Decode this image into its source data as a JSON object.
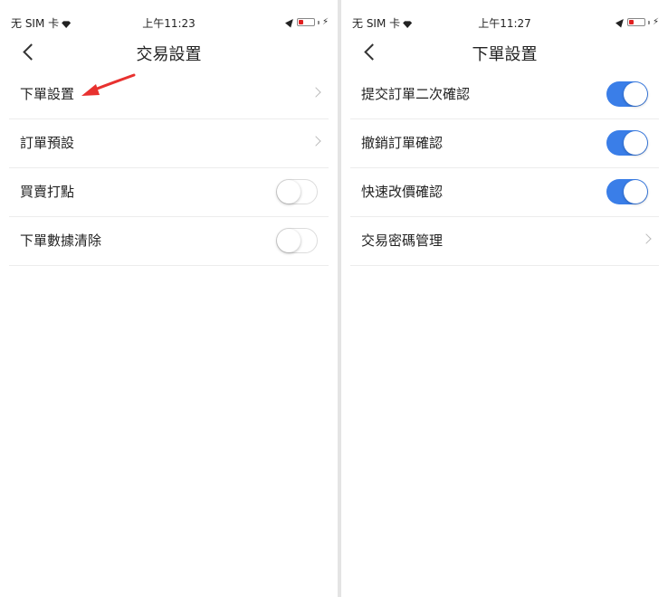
{
  "left": {
    "status": {
      "carrier": "无 SIM 卡",
      "time": "上午11:23"
    },
    "nav": {
      "title": "交易設置"
    },
    "items": [
      {
        "label": "下單設置",
        "control": "chevron"
      },
      {
        "label": "訂單預設",
        "control": "chevron"
      },
      {
        "label": "買賣打點",
        "control": "toggle",
        "on": false
      },
      {
        "label": "下單數據清除",
        "control": "toggle",
        "on": false
      }
    ]
  },
  "right": {
    "status": {
      "carrier": "无 SIM 卡",
      "time": "上午11:27"
    },
    "nav": {
      "title": "下單設置"
    },
    "items": [
      {
        "label": "提交訂單二次確認",
        "control": "toggle",
        "on": true
      },
      {
        "label": "撤銷訂單確認",
        "control": "toggle",
        "on": true
      },
      {
        "label": "快速改價確認",
        "control": "toggle",
        "on": true
      },
      {
        "label": "交易密碼管理",
        "control": "chevron"
      }
    ]
  },
  "colors": {
    "toggle_on": "#3a7ee8",
    "annotation_arrow": "#e8312f",
    "battery_low": "#e02020"
  }
}
